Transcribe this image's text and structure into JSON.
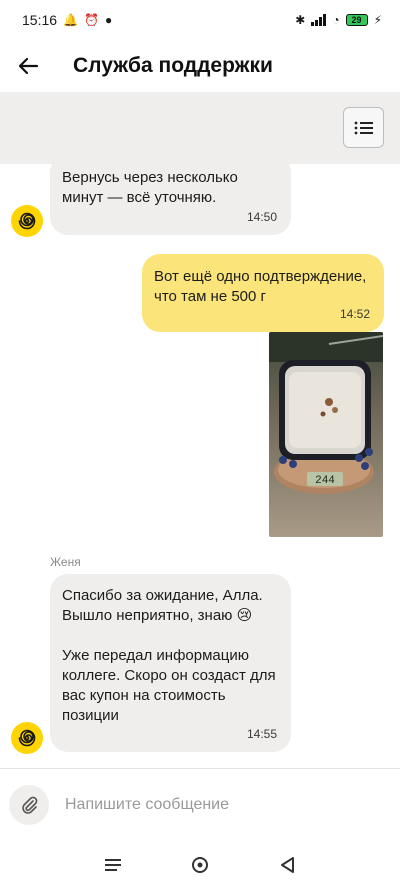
{
  "status_bar": {
    "time": "15:16",
    "battery": "29"
  },
  "header": {
    "title": "Служба поддержки"
  },
  "messages": [
    {
      "direction": "in",
      "text": "Вернусь через несколько\nминут — всё уточняю.",
      "time": "14:50"
    },
    {
      "direction": "out",
      "text": "Вот ещё одно подтверждение,\nчто там не 500 г",
      "time": "14:52"
    },
    {
      "direction": "out",
      "type": "photo",
      "scale_reading": "244"
    },
    {
      "direction": "in",
      "sender": "Женя",
      "text": "Спасибо за ожидание, Алла.\nВышло неприятно, знаю 😢\n\nУже передал информацию\nколлеге. Скоро он создаст для\nвас купон на стоимость\nпозиции",
      "time": "14:55"
    }
  ],
  "composer": {
    "placeholder": "Напишите сообщение"
  },
  "colors": {
    "incoming_bubble": "#efeeec",
    "outgoing_bubble": "#fbe57a",
    "avatar": "#ffd400"
  }
}
